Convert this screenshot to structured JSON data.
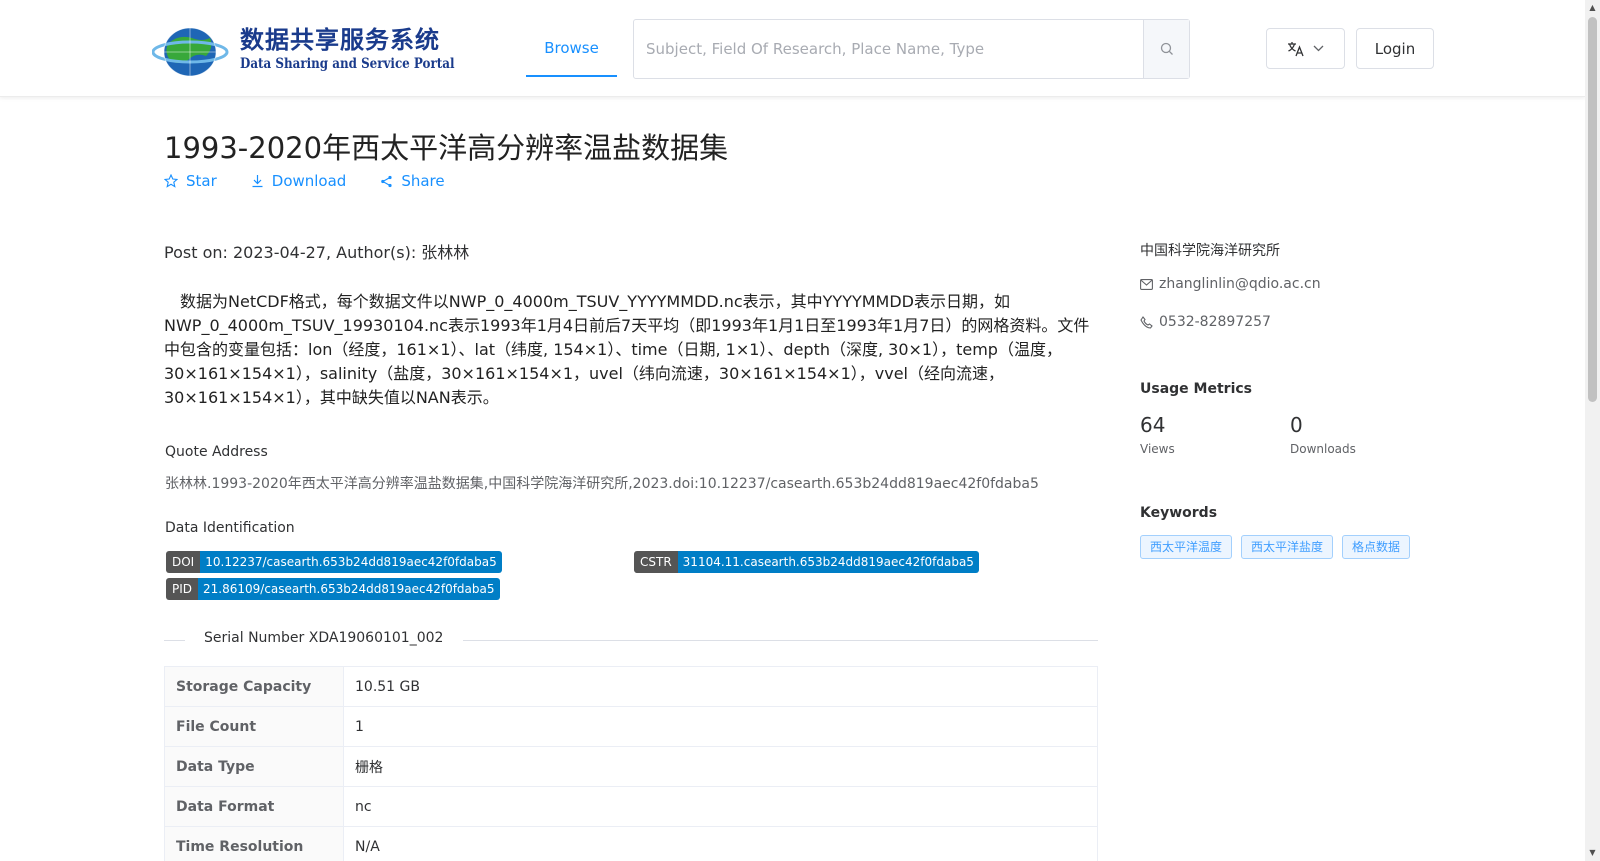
{
  "header": {
    "logo_cn": "数据共享服务系统",
    "logo_en": "Data Sharing and Service Portal",
    "nav_browse": "Browse",
    "search_placeholder": "Subject, Field Of Research, Place Name, Type",
    "login_label": "Login"
  },
  "dataset": {
    "title": "1993-2020年西太平洋高分辨率温盐数据集",
    "actions": {
      "star": "Star",
      "download": "Download",
      "share": "Share"
    },
    "post_on": "Post on: 2023-04-27, Author(s): 张林林",
    "description": "数据为NetCDF格式，每个数据文件以NWP_0_4000m_TSUV_YYYYMMDD.nc表示，其中YYYYMMDD表示日期，如NWP_0_4000m_TSUV_19930104.nc表示1993年1月4日前后7天平均（即1993年1月1日至1993年1月7日）的网格资料。文件中包含的变量包括：lon（经度，161×1）、lat（纬度, 154×1）、time（日期, 1×1）、depth（深度, 30×1），temp（温度，30×161×154×1），salinity（盐度，30×161×154×1，uvel（纬向流速，30×161×154×1），vvel（经向流速，30×161×154×1），其中缺失值以NAN表示。",
    "quote_label": "Quote Address",
    "quote_text": "张林林.1993-2020年西太平洋高分辨率温盐数据集,中国科学院海洋研究所,2023.doi:10.12237/casearth.653b24dd819aec42f0fdaba5",
    "data_id_label": "Data Identification",
    "identifiers": {
      "doi": {
        "key": "DOI",
        "value": "10.12237/casearth.653b24dd819aec42f0fdaba5"
      },
      "cstr": {
        "key": "CSTR",
        "value": "31104.11.casearth.653b24dd819aec42f0fdaba5"
      },
      "pid": {
        "key": "PID",
        "value": "21.86109/casearth.653b24dd819aec42f0fdaba5"
      }
    },
    "serial_number": "Serial Number XDA19060101_002",
    "properties": [
      {
        "label": "Storage Capacity",
        "value": "10.51 GB"
      },
      {
        "label": "File Count",
        "value": "1"
      },
      {
        "label": "Data Type",
        "value": "栅格"
      },
      {
        "label": "Data Format",
        "value": "nc"
      },
      {
        "label": "Time Resolution",
        "value": "N/A"
      }
    ]
  },
  "sidebar": {
    "organization": "中国科学院海洋研究所",
    "email": "zhanglinlin@qdio.ac.cn",
    "phone": "0532-82897257",
    "usage_title": "Usage Metrics",
    "views_count": "64",
    "views_label": "Views",
    "downloads_count": "0",
    "downloads_label": "Downloads",
    "keywords_title": "Keywords",
    "keywords": [
      "西太平洋温度",
      "西太平洋盐度",
      "格点数据"
    ]
  },
  "colors": {
    "accent": "#1890ff",
    "badge_key": "#555555",
    "badge_value": "#007ec6",
    "tag_bg": "#ecf5ff",
    "tag_text": "#409eff"
  }
}
